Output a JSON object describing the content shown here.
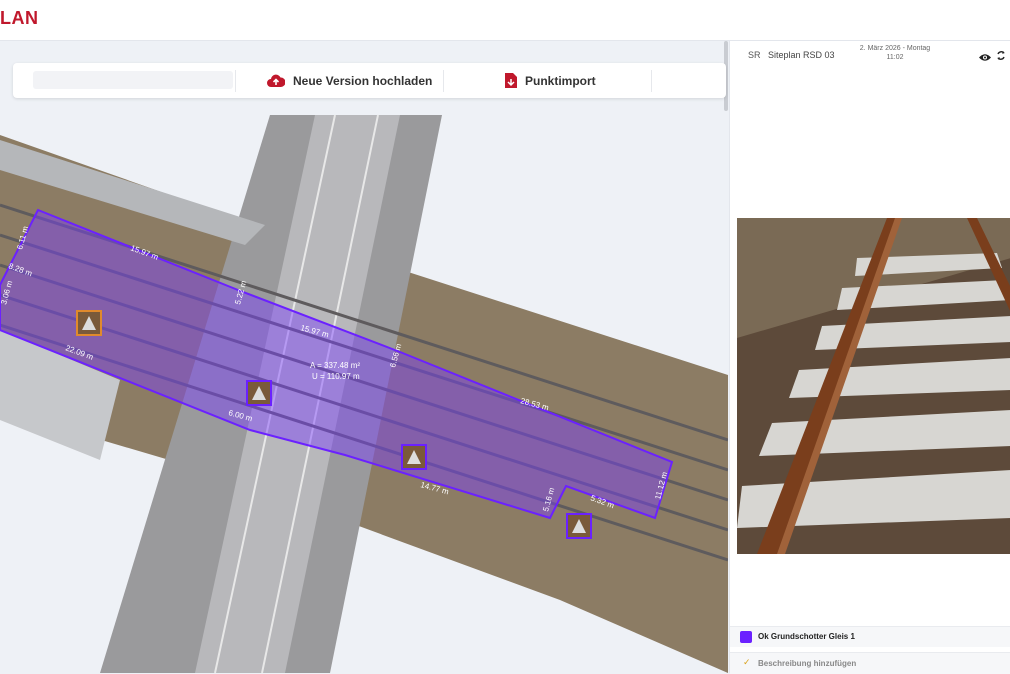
{
  "app": {
    "brand": "LAN"
  },
  "toolbar": {
    "upload_label": "Neue Version hochladen",
    "upload_icon": "cloud-upload-icon",
    "import_label": "Punktimport",
    "import_icon": "file-import-icon"
  },
  "map": {
    "area_label": "A = 337.48 m²",
    "perimeter_label": "U = 110.97 m",
    "measurements": [
      "15.97 m",
      "6.11 m",
      "15.97 m",
      "5.22 m",
      "6.56 m",
      "28.53 m",
      "11.12 m",
      "5.32 m",
      "22.09 m",
      "6.00 m",
      "14.77 m",
      "5.16 m",
      "8.28 m",
      "3.06 m"
    ],
    "polygon_color": "#6b21ff"
  },
  "panel": {
    "header": {
      "initials": "SR",
      "site_name": "Siteplan RSD 03",
      "date_line1": "2. März 2026 - Montag",
      "date_line2": "11:02"
    },
    "layer": {
      "name": "Ok Grundschotter Gleis 1",
      "color": "#6b21ff"
    },
    "description_action": "Beschreibung hinzufügen"
  }
}
